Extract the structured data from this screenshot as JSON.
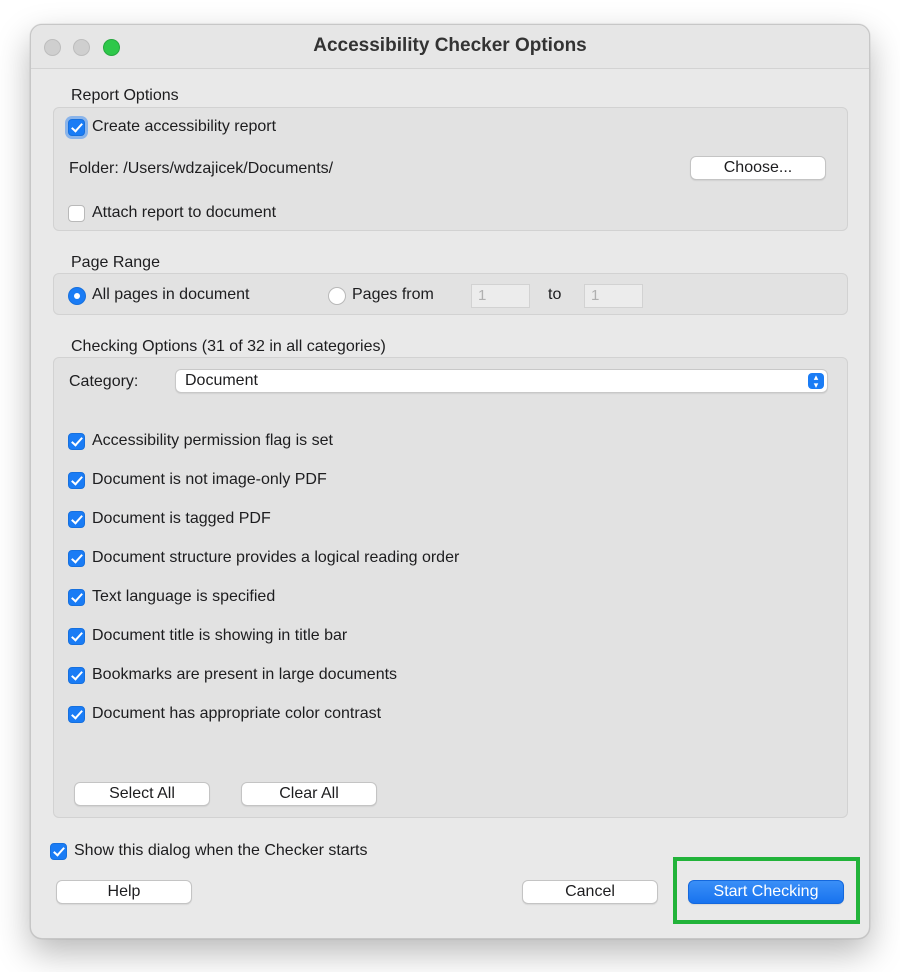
{
  "window": {
    "title": "Accessibility Checker Options"
  },
  "report_options": {
    "label": "Report Options",
    "create_report": {
      "label": "Create accessibility report",
      "checked": true
    },
    "folder_label": "Folder: /Users/wdzajicek/Documents/",
    "choose_button": "Choose...",
    "attach_report": {
      "label": "Attach report to document",
      "checked": false
    }
  },
  "page_range": {
    "label": "Page Range",
    "all_pages": {
      "label": "All pages in document",
      "selected": true
    },
    "pages_from": {
      "label": "Pages from",
      "selected": false
    },
    "from_value": "1",
    "to_label": "to",
    "to_value": "1"
  },
  "checking_options": {
    "label": "Checking Options (31 of 32 in all categories)",
    "category_label": "Category:",
    "category_value": "Document",
    "items": [
      {
        "label": "Accessibility permission flag is set",
        "checked": true
      },
      {
        "label": "Document is not image-only PDF",
        "checked": true
      },
      {
        "label": "Document is tagged PDF",
        "checked": true
      },
      {
        "label": "Document structure provides a logical reading order",
        "checked": true
      },
      {
        "label": "Text language is specified",
        "checked": true
      },
      {
        "label": "Document title is showing in title bar",
        "checked": true
      },
      {
        "label": "Bookmarks are present in large documents",
        "checked": true
      },
      {
        "label": "Document has appropriate color contrast",
        "checked": true
      }
    ],
    "select_all_button": "Select All",
    "clear_all_button": "Clear All"
  },
  "show_dialog": {
    "label": "Show this dialog when the Checker starts",
    "checked": true
  },
  "footer": {
    "help_button": "Help",
    "cancel_button": "Cancel",
    "start_button": "Start Checking"
  },
  "colors": {
    "accent": "#1a7cf5",
    "highlight": "#22b33a",
    "traffic_zoom": "#2ec84a"
  }
}
